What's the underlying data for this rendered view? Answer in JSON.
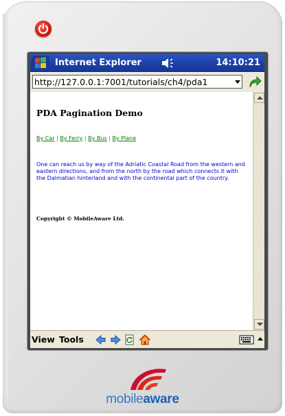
{
  "titlebar": {
    "app_title": "Internet Explorer",
    "clock": "14:10:21"
  },
  "addressbar": {
    "url": "http://127.0.0.1:7001/tutorials/ch4/pda1"
  },
  "page": {
    "title": "PDA Pagination Demo",
    "nav_links": [
      "By Car",
      "By Ferry",
      "By Bus",
      "By Plane"
    ],
    "separator": "|",
    "body": "One can reach us by way of the Adriatic Coastal Road from the western and eastern directions, and from the north by the road which connects it with the Dalmatian hinterland and with the continental part of the country.",
    "copyright": "Copyright © MobileAware Ltd."
  },
  "menubar": {
    "view": "View",
    "tools": "Tools"
  },
  "brand": {
    "mobile": "mobile",
    "aware": "aware"
  },
  "colors": {
    "titlebar": "#1c3fa5",
    "link_green": "#008000",
    "body_blue": "#0000cc",
    "power_red": "#d81b10",
    "brand_blue": "#1f5fb3"
  },
  "icons": [
    "power-icon",
    "windows-start-icon",
    "speaker-icon",
    "go-icon",
    "back-icon",
    "forward-icon",
    "refresh-icon",
    "home-icon",
    "keyboard-icon"
  ]
}
